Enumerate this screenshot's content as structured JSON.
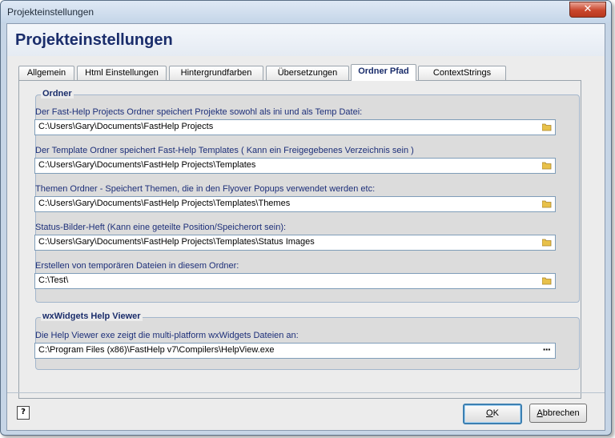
{
  "window": {
    "title": "Projekteinstellungen",
    "close_glyph": "✕"
  },
  "header": {
    "title": "Projekteinstellungen"
  },
  "tabs": [
    {
      "label": "Allgemein"
    },
    {
      "label": "Html Einstellungen"
    },
    {
      "label": "Hintergrundfarben"
    },
    {
      "label": "Übersetzungen"
    },
    {
      "label": "Ordner Pfad",
      "active": true
    },
    {
      "label": "ContextStrings"
    }
  ],
  "ordner": {
    "legend": "Ordner",
    "fields": [
      {
        "label": "Der Fast-Help Projects Ordner speichert Projekte sowohl als ini und als Temp Datei:",
        "value": "C:\\Users\\Gary\\Documents\\FastHelp Projects",
        "icon": "folder-icon"
      },
      {
        "label": "Der Template Ordner speichert Fast-Help Templates ( Kann ein Freigegebenes Verzeichnis sein )",
        "value": "C:\\Users\\Gary\\Documents\\FastHelp Projects\\Templates",
        "icon": "folder-icon"
      },
      {
        "label": "Themen Ordner - Speichert Themen, die in den Flyover Popups verwendet werden etc:",
        "value": "C:\\Users\\Gary\\Documents\\FastHelp Projects\\Templates\\Themes",
        "icon": "folder-icon"
      },
      {
        "label": "Status-Bilder-Heft (Kann eine geteilte Position/Speicherort sein):",
        "value": "C:\\Users\\Gary\\Documents\\FastHelp Projects\\Templates\\Status Images",
        "icon": "folder-icon"
      },
      {
        "label": "Erstellen von temporären Dateien in diesem Ordner:",
        "value": "C:\\Test\\",
        "icon": "folder-icon"
      }
    ]
  },
  "viewer": {
    "legend": "wxWidgets Help Viewer",
    "label": "Die Help Viewer exe zeigt die multi-platform wxWidgets Dateien an:",
    "value": "C:\\Program Files (x86)\\FastHelp v7\\Compilers\\HelpView.exe",
    "browse_label": "···"
  },
  "footer": {
    "help_glyph": "?",
    "ok_first": "O",
    "ok_rest": "K",
    "cancel_first": "A",
    "cancel_rest": "bbrechen"
  },
  "colors": {
    "accent": "#1a2d6b",
    "label": "#1d2f79",
    "folder": "#e8c14a"
  }
}
